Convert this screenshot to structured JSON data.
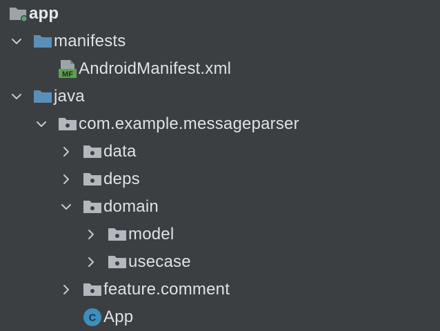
{
  "tree": {
    "root": {
      "label": "app",
      "icon": "module-folder-icon"
    },
    "items": [
      {
        "label": "manifests",
        "icon": "source-folder-icon",
        "expanded": true
      },
      {
        "label": "AndroidManifest.xml",
        "icon": "manifest-file-icon",
        "icon_text": "MF"
      },
      {
        "label": "java",
        "icon": "source-folder-icon",
        "expanded": true
      },
      {
        "label": "com.example.messageparser",
        "icon": "package-icon",
        "expanded": true
      },
      {
        "label": "data",
        "icon": "package-icon",
        "expanded": false
      },
      {
        "label": "deps",
        "icon": "package-icon",
        "expanded": false
      },
      {
        "label": "domain",
        "icon": "package-icon",
        "expanded": true
      },
      {
        "label": "model",
        "icon": "package-icon",
        "expanded": false
      },
      {
        "label": "usecase",
        "icon": "package-icon",
        "expanded": false
      },
      {
        "label": "feature.comment",
        "icon": "package-icon",
        "expanded": false
      },
      {
        "label": "App",
        "icon": "kotlin-class-icon",
        "icon_text": "C"
      }
    ]
  },
  "colors": {
    "background": "#3c3f41",
    "text": "#dfe1e5",
    "chevron": "#c6c9ce",
    "folder_blue": "#5a8fb7",
    "package_gray": "#b4b8be",
    "module_dot": "#59a869",
    "manifest_green": "#5fa14e",
    "class_blue": "#3d8fbd"
  }
}
